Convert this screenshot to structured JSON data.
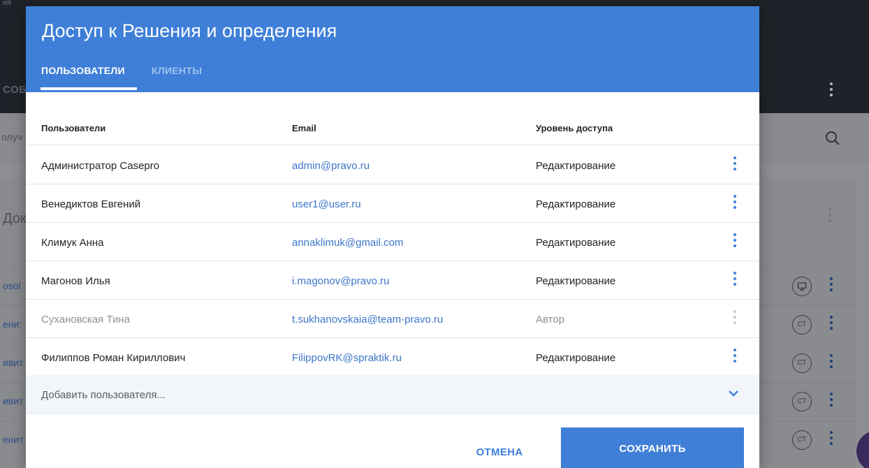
{
  "background": {
    "caption": "ия",
    "tab_fragment": "СОБ",
    "search_fragment": "олуч",
    "card_title_fragment": "Док",
    "rows": [
      {
        "link_fragment": "osol",
        "badge": ""
      },
      {
        "link_fragment": "ени:",
        "badge": "СТ"
      },
      {
        "link_fragment": "ивит",
        "badge": "СТ"
      },
      {
        "link_fragment": "ивит",
        "badge": "СТ"
      },
      {
        "link_fragment": "енит",
        "badge": "СТ"
      }
    ],
    "colors": {
      "topbar": "#1f2228",
      "overlay": "#8e8f93",
      "fab": "#3a2a5e"
    }
  },
  "dialog": {
    "title": "Доступ к Решения и определения",
    "tabs": [
      {
        "label": "ПОЛЬЗОВАТЕЛИ",
        "active": true
      },
      {
        "label": "КЛИЕНТЫ",
        "active": false
      }
    ],
    "table": {
      "headers": {
        "name": "Пользователи",
        "email": "Email",
        "level": "Уровень доступа"
      },
      "rows": [
        {
          "name": "Администратор Casepro",
          "email": "admin@pravo.ru",
          "level": "Редактирование",
          "disabled": false
        },
        {
          "name": "Венедиктов Евгений",
          "email": "user1@user.ru",
          "level": "Редактирование",
          "disabled": false
        },
        {
          "name": "Климук Анна",
          "email": "annaklimuk@gmail.com",
          "level": "Редактирование",
          "disabled": false
        },
        {
          "name": "Магонов Илья",
          "email": "i.magonov@pravo.ru",
          "level": "Редактирование",
          "disabled": false
        },
        {
          "name": "Сухановская Тина",
          "email": "t.sukhanovskaia@team-pravo.ru",
          "level": "Автор",
          "disabled": true
        },
        {
          "name": "Филиппов Роман Кириллович",
          "email": "FilippovRK@spraktik.ru",
          "level": "Редактирование",
          "disabled": false
        }
      ]
    },
    "add_user": {
      "placeholder": "Добавить пользователя...",
      "value": ""
    },
    "buttons": {
      "cancel": "ОТМЕНА",
      "save": "СОХРАНИТЬ"
    },
    "colors": {
      "accent": "#3f7fd8",
      "link": "#3d76c9",
      "disabled_text": "#8e9096"
    }
  }
}
